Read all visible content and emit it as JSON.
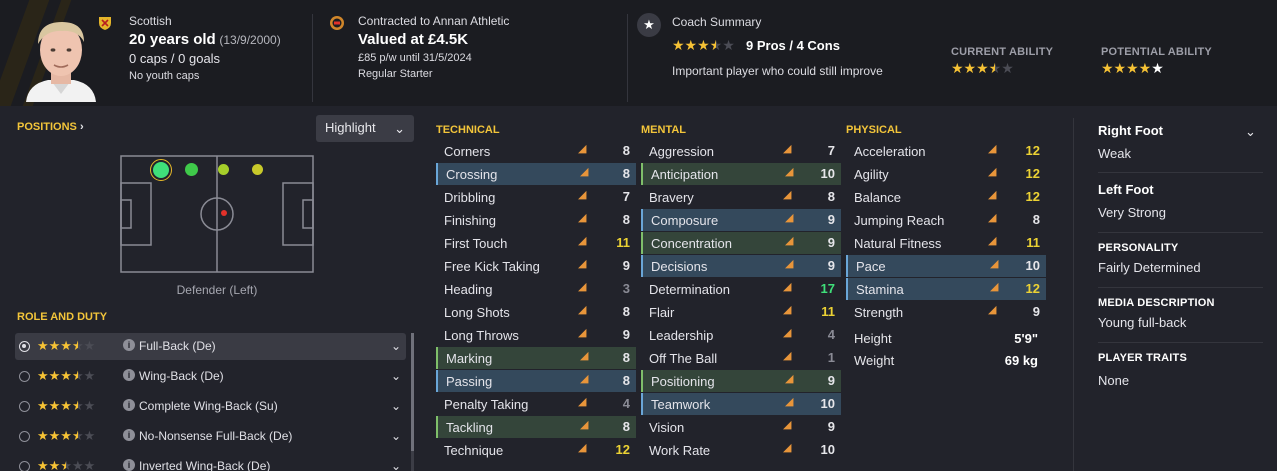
{
  "header": {
    "nation": "Scottish",
    "age": "20 years old",
    "dob": "(13/9/2000)",
    "caps": "0 caps / 0 goals",
    "youth_caps": "No youth caps",
    "contract": "Contracted to Annan Athletic",
    "value": "Valued at £4.5K",
    "wage": "£85 p/w until 31/5/2024",
    "status": "Regular Starter",
    "coach_title": "Coach Summary",
    "pros_cons": "9 Pros / 4 Cons",
    "coach_summary_rating": 3.5,
    "summary_text": "Important player who could still improve",
    "current_ability_label": "CURRENT ABILITY",
    "current_ability_rating": 3.5,
    "potential_ability_label": "POTENTIAL ABILITY",
    "potential_ability_rating": 5,
    "accent_color": "#f3c53a"
  },
  "positions": {
    "title": "POSITIONS",
    "title_icon": "chevron-right-icon",
    "highlight_label": "Highlight",
    "pitch_caption": "Defender (Left)"
  },
  "roles": {
    "title": "ROLE AND DUTY",
    "items": [
      {
        "name": "Full-Back (De)",
        "rating": 3.5,
        "selected": true
      },
      {
        "name": "Wing-Back (De)",
        "rating": 3.5,
        "selected": false
      },
      {
        "name": "Complete Wing-Back (Su)",
        "rating": 3.5,
        "selected": false
      },
      {
        "name": "No-Nonsense Full-Back (De)",
        "rating": 3.5,
        "selected": false
      },
      {
        "name": "Inverted Wing-Back (De)",
        "rating": 2.5,
        "selected": false
      }
    ]
  },
  "technical": {
    "title": "TECHNICAL",
    "attributes": [
      {
        "name": "Corners",
        "value": "8",
        "color": "white",
        "highlight": ""
      },
      {
        "name": "Crossing",
        "value": "8",
        "color": "white",
        "highlight": "blue"
      },
      {
        "name": "Dribbling",
        "value": "7",
        "color": "white",
        "highlight": ""
      },
      {
        "name": "Finishing",
        "value": "8",
        "color": "white",
        "highlight": ""
      },
      {
        "name": "First Touch",
        "value": "11",
        "color": "yellow",
        "highlight": ""
      },
      {
        "name": "Free Kick Taking",
        "value": "9",
        "color": "white",
        "highlight": ""
      },
      {
        "name": "Heading",
        "value": "3",
        "color": "grey",
        "highlight": ""
      },
      {
        "name": "Long Shots",
        "value": "8",
        "color": "white",
        "highlight": ""
      },
      {
        "name": "Long Throws",
        "value": "9",
        "color": "white",
        "highlight": ""
      },
      {
        "name": "Marking",
        "value": "8",
        "color": "white",
        "highlight": "green"
      },
      {
        "name": "Passing",
        "value": "8",
        "color": "white",
        "highlight": "blue"
      },
      {
        "name": "Penalty Taking",
        "value": "4",
        "color": "grey",
        "highlight": ""
      },
      {
        "name": "Tackling",
        "value": "8",
        "color": "white",
        "highlight": "green"
      },
      {
        "name": "Technique",
        "value": "12",
        "color": "yellow",
        "highlight": ""
      }
    ]
  },
  "mental": {
    "title": "MENTAL",
    "attributes": [
      {
        "name": "Aggression",
        "value": "7",
        "color": "white",
        "highlight": ""
      },
      {
        "name": "Anticipation",
        "value": "10",
        "color": "white",
        "highlight": "green"
      },
      {
        "name": "Bravery",
        "value": "8",
        "color": "white",
        "highlight": ""
      },
      {
        "name": "Composure",
        "value": "9",
        "color": "white",
        "highlight": "blue"
      },
      {
        "name": "Concentration",
        "value": "9",
        "color": "white",
        "highlight": "green"
      },
      {
        "name": "Decisions",
        "value": "9",
        "color": "white",
        "highlight": "blue"
      },
      {
        "name": "Determination",
        "value": "17",
        "color": "green",
        "highlight": ""
      },
      {
        "name": "Flair",
        "value": "11",
        "color": "yellow",
        "highlight": ""
      },
      {
        "name": "Leadership",
        "value": "4",
        "color": "grey",
        "highlight": ""
      },
      {
        "name": "Off The Ball",
        "value": "1",
        "color": "grey",
        "highlight": ""
      },
      {
        "name": "Positioning",
        "value": "9",
        "color": "white",
        "highlight": "green"
      },
      {
        "name": "Teamwork",
        "value": "10",
        "color": "white",
        "highlight": "blue"
      },
      {
        "name": "Vision",
        "value": "9",
        "color": "white",
        "highlight": ""
      },
      {
        "name": "Work Rate",
        "value": "10",
        "color": "white",
        "highlight": ""
      }
    ]
  },
  "physical": {
    "title": "PHYSICAL",
    "attributes": [
      {
        "name": "Acceleration",
        "value": "12",
        "color": "yellow",
        "highlight": ""
      },
      {
        "name": "Agility",
        "value": "12",
        "color": "yellow",
        "highlight": ""
      },
      {
        "name": "Balance",
        "value": "12",
        "color": "yellow",
        "highlight": ""
      },
      {
        "name": "Jumping Reach",
        "value": "8",
        "color": "white",
        "highlight": ""
      },
      {
        "name": "Natural Fitness",
        "value": "11",
        "color": "yellow",
        "highlight": ""
      },
      {
        "name": "Pace",
        "value": "10",
        "color": "white",
        "highlight": "blue"
      },
      {
        "name": "Stamina",
        "value": "12",
        "color": "yellow",
        "highlight": "blue"
      },
      {
        "name": "Strength",
        "value": "9",
        "color": "white",
        "highlight": ""
      }
    ],
    "height_label": "Height",
    "height_value": "5'9\"",
    "weight_label": "Weight",
    "weight_value": "69 kg"
  },
  "info": {
    "right_foot_label": "Right Foot",
    "right_foot_value": "Weak",
    "left_foot_label": "Left Foot",
    "left_foot_value": "Very Strong",
    "personality_label": "PERSONALITY",
    "personality_value": "Fairly Determined",
    "media_label": "MEDIA DESCRIPTION",
    "media_value": "Young full-back",
    "traits_label": "PLAYER TRAITS",
    "traits_value": "None"
  }
}
